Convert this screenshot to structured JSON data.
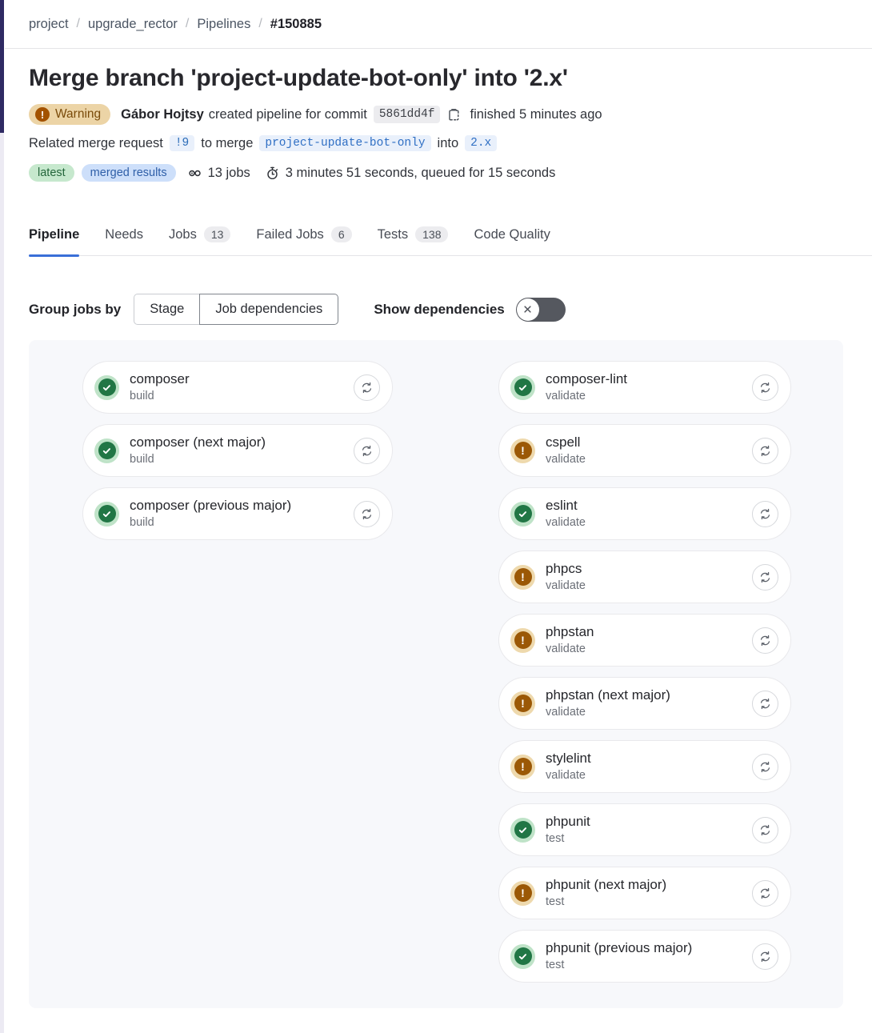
{
  "breadcrumb": {
    "items": [
      {
        "label": "project",
        "current": false
      },
      {
        "label": "upgrade_rector",
        "current": false
      },
      {
        "label": "Pipelines",
        "current": false
      },
      {
        "label": "#150885",
        "current": true
      }
    ],
    "separator": "/"
  },
  "header": {
    "title": "Merge branch 'project-update-bot-only' into '2.x'",
    "status_badge": {
      "label": "Warning",
      "icon": "warning-icon",
      "bg": "#ecd4a6",
      "fg": "#7a4b0a"
    },
    "author": "Gábor Hojtsy",
    "created_text": "created pipeline for commit",
    "commit_sha": "5861dd4f",
    "copy_icon": "copy-to-clipboard-icon",
    "finished_text": "finished 5 minutes ago",
    "merge_request_prefix": "Related merge request",
    "merge_request_id": "!9",
    "merge_text": "to merge",
    "source_branch": "project-update-bot-only",
    "into_text": "into",
    "target_branch": "2.x",
    "tag_latest": "latest",
    "tag_merged_results": "merged results",
    "jobs_icon": "pipeline-jobs-icon",
    "jobs_count": "13 jobs",
    "duration_icon": "stopwatch-icon",
    "duration": "3 minutes 51 seconds, queued for 15 seconds"
  },
  "tabs": [
    {
      "label": "Pipeline",
      "count": null,
      "active": true
    },
    {
      "label": "Needs",
      "count": null,
      "active": false
    },
    {
      "label": "Jobs",
      "count": "13",
      "active": false
    },
    {
      "label": "Failed Jobs",
      "count": "6",
      "active": false
    },
    {
      "label": "Tests",
      "count": "138",
      "active": false
    },
    {
      "label": "Code Quality",
      "count": null,
      "active": false
    }
  ],
  "controls": {
    "group_label": "Group jobs by",
    "segments": [
      {
        "label": "Stage",
        "selected": false
      },
      {
        "label": "Job dependencies",
        "selected": true
      }
    ],
    "show_dependencies_label": "Show dependencies",
    "show_dependencies_on": false,
    "toggle_icon": "close-x-icon"
  },
  "graph": {
    "columns": [
      {
        "name": "build-column",
        "jobs": [
          {
            "name": "composer",
            "stage": "build",
            "status": "success",
            "retry_icon": "retry-icon"
          },
          {
            "name": "composer (next major)",
            "stage": "build",
            "status": "success",
            "retry_icon": "retry-icon"
          },
          {
            "name": "composer (previous major)",
            "stage": "build",
            "status": "success",
            "retry_icon": "retry-icon"
          }
        ]
      },
      {
        "name": "dependent-column",
        "jobs": [
          {
            "name": "composer-lint",
            "stage": "validate",
            "status": "success",
            "retry_icon": "retry-icon"
          },
          {
            "name": "cspell",
            "stage": "validate",
            "status": "warning",
            "retry_icon": "retry-icon"
          },
          {
            "name": "eslint",
            "stage": "validate",
            "status": "success",
            "retry_icon": "retry-icon"
          },
          {
            "name": "phpcs",
            "stage": "validate",
            "status": "warning",
            "retry_icon": "retry-icon"
          },
          {
            "name": "phpstan",
            "stage": "validate",
            "status": "warning",
            "retry_icon": "retry-icon"
          },
          {
            "name": "phpstan (next major)",
            "stage": "validate",
            "status": "warning",
            "retry_icon": "retry-icon"
          },
          {
            "name": "stylelint",
            "stage": "validate",
            "status": "warning",
            "retry_icon": "retry-icon"
          },
          {
            "name": "phpunit",
            "stage": "test",
            "status": "success",
            "retry_icon": "retry-icon"
          },
          {
            "name": "phpunit (next major)",
            "stage": "test",
            "status": "warning",
            "retry_icon": "retry-icon"
          },
          {
            "name": "phpunit (previous major)",
            "stage": "test",
            "status": "success",
            "retry_icon": "retry-icon"
          }
        ]
      }
    ]
  },
  "colors": {
    "accent": "#3a6fd8",
    "success": "#217645",
    "success_halo": "#bfe3c8",
    "warning": "#9b5806",
    "warning_halo": "#eed9ad",
    "link": "#2f6fc4",
    "graph_bg": "#f7f8fb",
    "scrollbar": "#2f2a63"
  }
}
